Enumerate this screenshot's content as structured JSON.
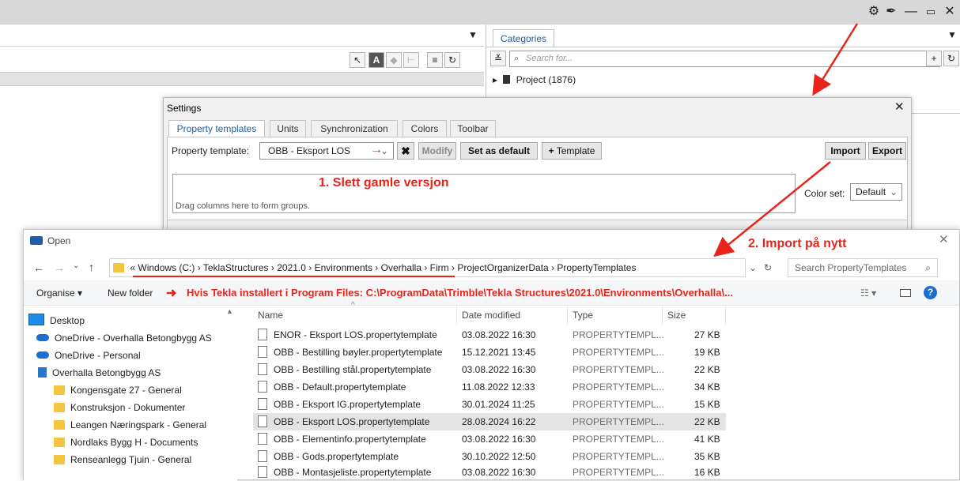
{
  "app": {
    "window_controls": [
      "⚙",
      "✒",
      "—",
      "▭",
      "✕"
    ]
  },
  "categories_panel": {
    "tab": "Categories",
    "search_placeholder": "Search for...",
    "tree_item": "Project (1876)"
  },
  "settings": {
    "title": "Settings",
    "tabs": [
      "Property templates",
      "Units",
      "Synchronization",
      "Colors",
      "Toolbar"
    ],
    "property_template_label": "Property template:",
    "property_template_value": "OBB - Eksport LOS",
    "modify_label": "Modify",
    "set_default_label": "Set as default",
    "add_template_label": "Template",
    "import_label": "Import",
    "export_label": "Export",
    "groupbox_hint": "Drag columns here to form groups.",
    "color_set_label": "Color set:",
    "color_set_value": "Default"
  },
  "annotations": {
    "step1": "1. Slett gamle versjon",
    "step2": "2. Import på nytt",
    "note": "Hvis Tekla installert i Program Files: C:\\ProgramData\\Trimble\\Tekla Structures\\2021.0\\Environments\\Overhalla\\...",
    "color": "#e8251a"
  },
  "open_dialog": {
    "title": "Open",
    "breadcrumb": [
      "«",
      "Windows (C:)",
      "TeklaStructures",
      "2021.0",
      "Environments",
      "Overhalla",
      "Firm",
      "ProjectOrganizerData",
      "PropertyTemplates"
    ],
    "search_placeholder": "Search PropertyTemplates",
    "organise_label": "Organise ▾",
    "new_folder_label": "New folder",
    "nav_items": [
      {
        "label": "Desktop",
        "icon": "desktop-icon"
      },
      {
        "label": "OneDrive - Overhalla Betongbygg AS",
        "icon": "cloud-icon"
      },
      {
        "label": "OneDrive - Personal",
        "icon": "cloud-icon"
      },
      {
        "label": "Overhalla Betongbygg AS",
        "icon": "building-icon"
      },
      {
        "label": "Kongensgate 27 - General",
        "icon": "folder-icon"
      },
      {
        "label": "Konstruksjon - Dokumenter",
        "icon": "folder-icon"
      },
      {
        "label": "Leangen Næringspark - General",
        "icon": "folder-icon"
      },
      {
        "label": "Nordlaks Bygg H - Documents",
        "icon": "folder-icon"
      },
      {
        "label": "Renseanlegg Tjuin - General",
        "icon": "folder-icon"
      }
    ],
    "columns": [
      "Name",
      "Date modified",
      "Type",
      "Size"
    ],
    "files": [
      {
        "name": "ENOR - Eksport LOS.propertytemplate",
        "date": "03.08.2022 16:30",
        "type": "PROPERTYTEMPL...",
        "size": "27 KB",
        "selected": false
      },
      {
        "name": "OBB - Bestilling bøyler.propertytemplate",
        "date": "15.12.2021 13:45",
        "type": "PROPERTYTEMPL...",
        "size": "19 KB",
        "selected": false
      },
      {
        "name": "OBB - Bestilling stål.propertytemplate",
        "date": "03.08.2022 16:30",
        "type": "PROPERTYTEMPL...",
        "size": "22 KB",
        "selected": false
      },
      {
        "name": "OBB - Default.propertytemplate",
        "date": "11.08.2022 12:33",
        "type": "PROPERTYTEMPL...",
        "size": "34 KB",
        "selected": false
      },
      {
        "name": "OBB - Eksport IG.propertytemplate",
        "date": "30.01.2024 11:25",
        "type": "PROPERTYTEMPL...",
        "size": "15 KB",
        "selected": false
      },
      {
        "name": "OBB - Eksport LOS.propertytemplate",
        "date": "28.08.2024 16:22",
        "type": "PROPERTYTEMPL...",
        "size": "22 KB",
        "selected": true
      },
      {
        "name": "OBB - Elementinfo.propertytemplate",
        "date": "03.08.2022 16:30",
        "type": "PROPERTYTEMPL...",
        "size": "41 KB",
        "selected": false
      },
      {
        "name": "OBB - Gods.propertytemplate",
        "date": "30.10.2022 12:50",
        "type": "PROPERTYTEMPL...",
        "size": "35 KB",
        "selected": false
      },
      {
        "name": "OBB - Montasjeliste.propertytemplate",
        "date": "03.08.2022 16:30",
        "type": "PROPERTYTEMPL...",
        "size": "16 KB",
        "selected": false
      }
    ]
  }
}
